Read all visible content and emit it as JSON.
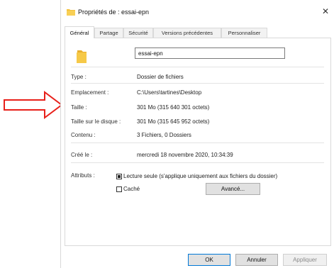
{
  "window": {
    "title": "Propriétés de : essai-epn",
    "close_glyph": "✕",
    "title_icon": "folder-icon"
  },
  "tabs": [
    {
      "label": "Général",
      "active": true
    },
    {
      "label": "Partage"
    },
    {
      "label": "Sécurité"
    },
    {
      "label": "Versions précédentes"
    },
    {
      "label": "Personnaliser"
    }
  ],
  "general": {
    "name_value": "essai-epn",
    "type_label": "Type :",
    "type_value": "Dossier de fichiers",
    "location_label": "Emplacement :",
    "location_value": "C:\\Users\\tartines\\Desktop",
    "size_label": "Taille :",
    "size_value": "301 Mo (315 640 301 octets)",
    "disk_size_label": "Taille sur le disque :",
    "disk_size_value": "301 Mo (315 645 952 octets)",
    "contents_label": "Contenu :",
    "contents_value": "3 Fichiers, 0 Dossiers",
    "created_label": "Créé le :",
    "created_value": "mercredi 18 novembre 2020, 10:34:39",
    "attributes_label": "Attributs :",
    "readonly_label": "Lecture seule (s'applique uniquement aux fichiers du dossier)",
    "readonly_checked": true,
    "hidden_label": "Caché",
    "hidden_checked": false,
    "advanced_button": "Avancé..."
  },
  "footer": {
    "ok": "OK",
    "cancel": "Annuler",
    "apply": "Appliquer"
  },
  "colors": {
    "arrow": "#e8201a",
    "folder": "#f4c13a",
    "accent": "#0078d7"
  },
  "annotation": {
    "icon": "red-arrow-icon",
    "points_to": "size_label"
  }
}
